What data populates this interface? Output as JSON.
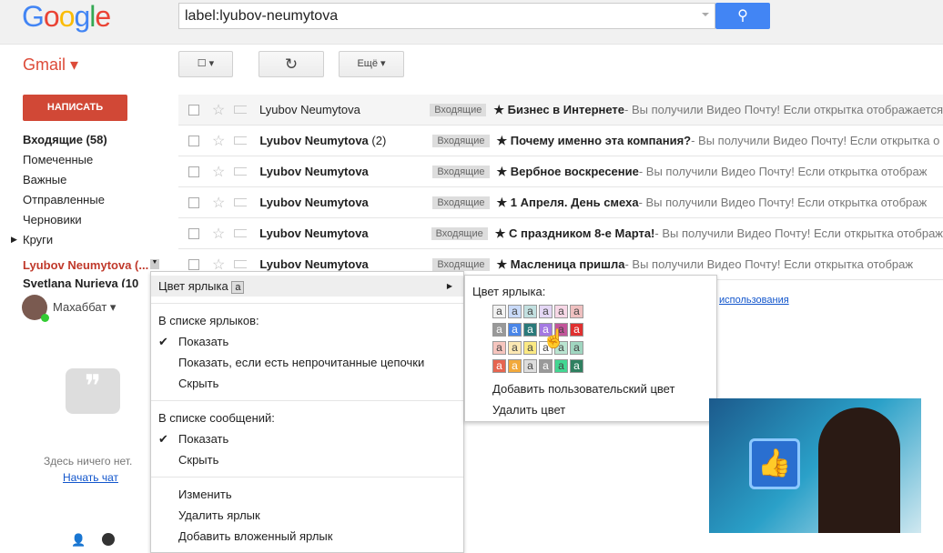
{
  "header": {
    "logo": "Google",
    "search_value": "label:lyubov-neumytova",
    "search_icon": "magnifier"
  },
  "toolbar": {
    "app": "Gmail ▾",
    "select": "☐ ▾",
    "refresh": "↻",
    "more": "Ещё ▾"
  },
  "sidebar": {
    "compose": "НАПИСАТЬ",
    "items": [
      "Входящие (58)",
      "Помеченные",
      "Важные",
      "Отправленные",
      "Черновики",
      "Круги"
    ],
    "label_active": "Lyubov Neumytova (...",
    "label_next": "Svetlana Nurieva (10",
    "user": "Махаббат ▾",
    "no_chats": "Здесь ничего нет.",
    "start_chat": "Начать чат"
  },
  "emails": [
    {
      "sender": "Lyubov Neumytova",
      "count": "",
      "label": "Входящие",
      "subject": "★ Бизнес в Интернете",
      "snippet": " - Вы получили Видео Почту! Если открытка отображается",
      "read": true
    },
    {
      "sender": "Lyubov Neumytova",
      "count": " (2)",
      "label": "Входящие",
      "subject": "★ Почему именно эта компания?",
      "snippet": " - Вы получили Видео Почту! Если открытка о",
      "read": false
    },
    {
      "sender": "Lyubov Neumytova",
      "count": "",
      "label": "Входящие",
      "subject": "★ Вербное воскресение",
      "snippet": " - Вы получили Видео Почту! Если открытка отображ",
      "read": false
    },
    {
      "sender": "Lyubov Neumytova",
      "count": "",
      "label": "Входящие",
      "subject": "★ 1 Апреля. День смеха",
      "snippet": " - Вы получили Видео Почту! Если открытка отображ",
      "read": false
    },
    {
      "sender": "Lyubov Neumytova",
      "count": "",
      "label": "Входящие",
      "subject": "★ С праздником 8-е Марта!",
      "snippet": " - Вы получили Видео Почту! Если открытка отображ",
      "read": false
    },
    {
      "sender": "Lyubov Neumytova",
      "count": "",
      "label": "Входящие",
      "subject": "★ Масленица пришла",
      "snippet": " - Вы получили Видео Почту! Если открытка отображ",
      "read": false
    }
  ],
  "footer_link": "использования",
  "context_menu": {
    "color": "Цвет ярлыка",
    "color_sample": "a",
    "in_labels": "В списке ярлыков:",
    "show": "Показать",
    "show_unread": "Показать, если есть непрочитанные цепочки",
    "hide": "Скрыть",
    "in_messages": "В списке сообщений:",
    "show2": "Показать",
    "hide2": "Скрыть",
    "edit": "Изменить",
    "delete": "Удалить ярлык",
    "add_nested": "Добавить вложенный ярлык"
  },
  "color_menu": {
    "title": "Цвет ярлыка:",
    "letter": "a",
    "add_custom": "Добавить пользовательский цвет",
    "remove": "Удалить цвет",
    "swatches": [
      [
        "#f2f2f2",
        "#c9daf8",
        "#c2e0e0",
        "#e4d7f5",
        "#f7d7e6",
        "#efc0c0"
      ],
      [
        "#999999",
        "#4a86e8",
        "#2a7a7a",
        "#a479e2",
        "#c2559a",
        "#e03030"
      ],
      [
        "#f6c5be",
        "#fce8b3",
        "#fbe983",
        "#ffffff",
        "#b9e4d0",
        "#a0d6c0"
      ],
      [
        "#e66550",
        "#f2a93b",
        "#dddddd",
        "#999999",
        "#43d692",
        "#2f8060"
      ]
    ],
    "dark": [
      [
        false,
        false,
        false,
        false,
        false,
        false
      ],
      [
        true,
        true,
        true,
        true,
        false,
        true
      ],
      [
        false,
        false,
        false,
        false,
        false,
        false
      ],
      [
        true,
        true,
        false,
        true,
        false,
        true
      ]
    ]
  }
}
